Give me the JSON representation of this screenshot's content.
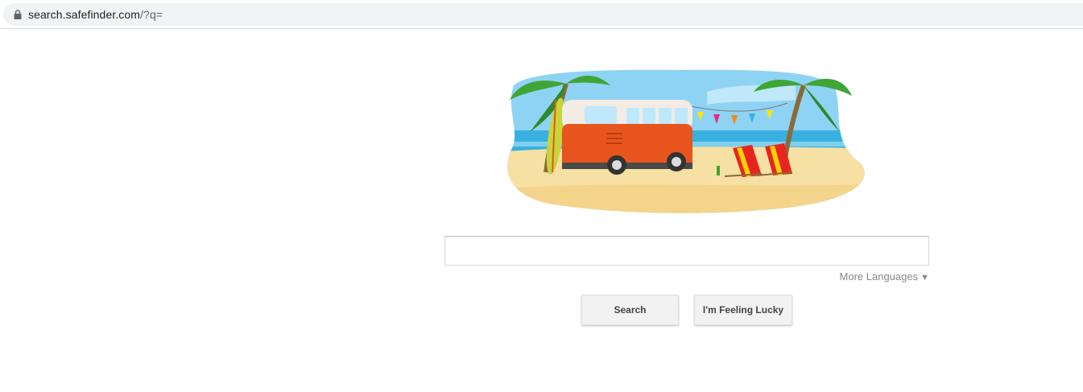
{
  "browser": {
    "url_host": "search.safefinder.com",
    "url_path": "/?q="
  },
  "search": {
    "value": "",
    "placeholder": ""
  },
  "more_languages": {
    "label": "More Languages",
    "caret": "▼"
  },
  "buttons": {
    "search_label": "Search",
    "lucky_label": "I'm Feeling Lucky"
  },
  "colors": {
    "van_body": "#e8541e",
    "van_top": "#f2ece4",
    "sky": "#8fd3f4",
    "sea": "#3ab0e0",
    "sand": "#f7e0a3",
    "palm": "#3fa535"
  },
  "icons": {
    "address_lock": "lock-icon"
  }
}
